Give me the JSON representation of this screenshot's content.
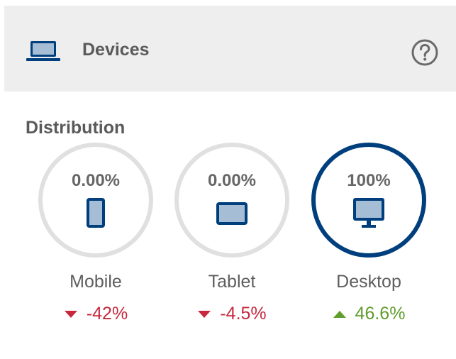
{
  "header": {
    "title": "Devices",
    "icon": "laptop-icon",
    "help_icon": "help-icon"
  },
  "section": {
    "label": "Distribution"
  },
  "colors": {
    "accent": "#003f7d",
    "ring_track": "#e0e0e0",
    "negative": "#c6283e",
    "positive": "#5f9d2c"
  },
  "devices": [
    {
      "label": "Mobile",
      "percent": "0.00%",
      "share": 0,
      "change": "-42%",
      "direction": "down",
      "icon": "mobile-icon"
    },
    {
      "label": "Tablet",
      "percent": "0.00%",
      "share": 0,
      "change": "-4.5%",
      "direction": "down",
      "icon": "tablet-icon"
    },
    {
      "label": "Desktop",
      "percent": "100%",
      "share": 1,
      "change": "46.6%",
      "direction": "up",
      "icon": "desktop-icon"
    }
  ]
}
